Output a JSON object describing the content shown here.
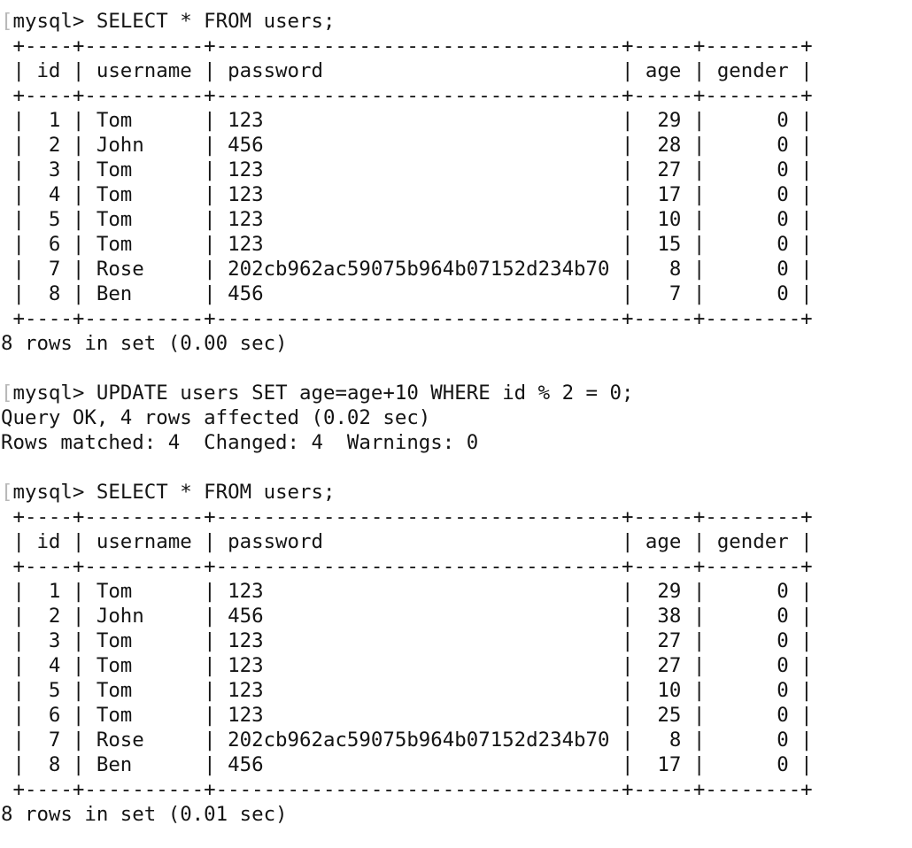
{
  "terminal": {
    "prompt": "mysql>",
    "prompt_prefix_glyph": "[",
    "colors": {
      "background": "#ffffff",
      "text": "#141414",
      "dim_bracket": "#b8b8b8"
    }
  },
  "table_schema": {
    "columns": [
      "id",
      "username",
      "password",
      "age",
      "gender"
    ],
    "widths": [
      4,
      10,
      34,
      5,
      8
    ],
    "border": "+----+----------+----------------------------------+-----+--------+",
    "header_row": "| id | username | password                         | age | gender |"
  },
  "blocks": [
    {
      "kind": "query",
      "command": "SELECT * FROM users;",
      "result": {
        "type": "table",
        "headers": [
          "id",
          "username",
          "password",
          "age",
          "gender"
        ],
        "rows": [
          {
            "id": "1",
            "username": "Tom",
            "password": "123",
            "age": "29",
            "gender": "0"
          },
          {
            "id": "2",
            "username": "John",
            "password": "456",
            "age": "28",
            "gender": "0"
          },
          {
            "id": "3",
            "username": "Tom",
            "password": "123",
            "age": "27",
            "gender": "0"
          },
          {
            "id": "4",
            "username": "Tom",
            "password": "123",
            "age": "17",
            "gender": "0"
          },
          {
            "id": "5",
            "username": "Tom",
            "password": "123",
            "age": "10",
            "gender": "0"
          },
          {
            "id": "6",
            "username": "Tom",
            "password": "123",
            "age": "15",
            "gender": "0"
          },
          {
            "id": "7",
            "username": "Rose",
            "password": "202cb962ac59075b964b07152d234b70",
            "age": "8",
            "gender": "0"
          },
          {
            "id": "8",
            "username": "Ben",
            "password": "456",
            "age": "7",
            "gender": "0"
          }
        ],
        "status": "8 rows in set (0.00 sec)"
      }
    },
    {
      "kind": "query",
      "command": "UPDATE users SET age=age+10 WHERE id % 2 = 0;",
      "result": {
        "type": "status",
        "lines": [
          "Query OK, 4 rows affected (0.02 sec)",
          "Rows matched: 4  Changed: 4  Warnings: 0"
        ]
      }
    },
    {
      "kind": "query",
      "command": "SELECT * FROM users;",
      "result": {
        "type": "table",
        "headers": [
          "id",
          "username",
          "password",
          "age",
          "gender"
        ],
        "rows": [
          {
            "id": "1",
            "username": "Tom",
            "password": "123",
            "age": "29",
            "gender": "0"
          },
          {
            "id": "2",
            "username": "John",
            "password": "456",
            "age": "38",
            "gender": "0"
          },
          {
            "id": "3",
            "username": "Tom",
            "password": "123",
            "age": "27",
            "gender": "0"
          },
          {
            "id": "4",
            "username": "Tom",
            "password": "123",
            "age": "27",
            "gender": "0"
          },
          {
            "id": "5",
            "username": "Tom",
            "password": "123",
            "age": "10",
            "gender": "0"
          },
          {
            "id": "6",
            "username": "Tom",
            "password": "123",
            "age": "25",
            "gender": "0"
          },
          {
            "id": "7",
            "username": "Rose",
            "password": "202cb962ac59075b964b07152d234b70",
            "age": "8",
            "gender": "0"
          },
          {
            "id": "8",
            "username": "Ben",
            "password": "456",
            "age": "17",
            "gender": "0"
          }
        ],
        "status": "8 rows in set (0.01 sec)"
      }
    }
  ]
}
